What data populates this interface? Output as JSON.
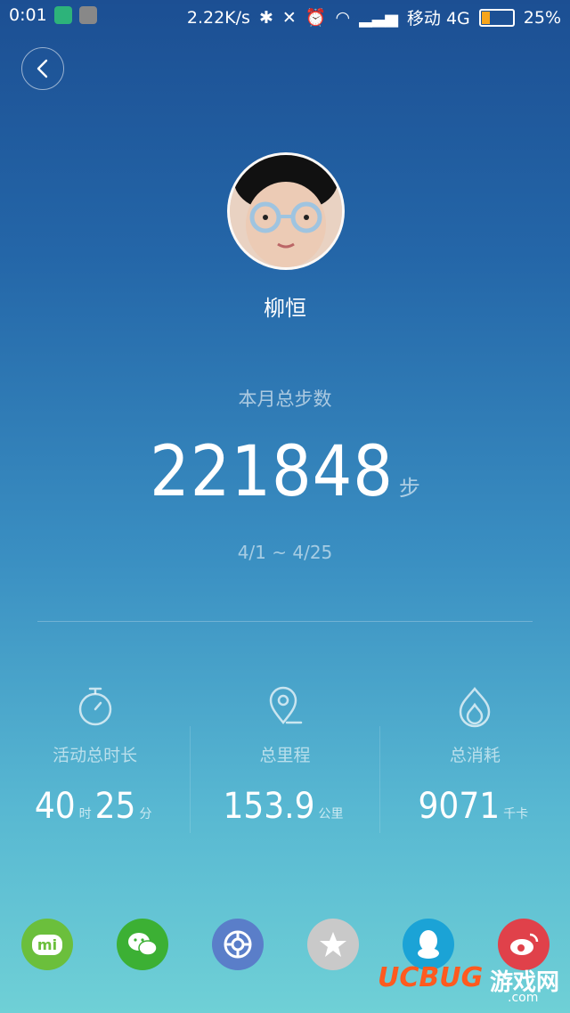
{
  "status_bar": {
    "time": "0:01",
    "network_speed": "2.22K/s",
    "carrier": "移动 4G",
    "battery": "25%",
    "battery_level": 0.25
  },
  "profile": {
    "name": "柳恒"
  },
  "summary": {
    "label": "本月总步数",
    "steps": "221848",
    "unit": "步",
    "date_range": "4/1 ~ 4/25"
  },
  "stats": {
    "duration": {
      "label": "活动总时长",
      "hours": "40",
      "hours_unit": "时",
      "minutes": "25",
      "minutes_unit": "分",
      "icon": "stopwatch-icon"
    },
    "distance": {
      "label": "总里程",
      "value": "153.9",
      "unit": "公里",
      "icon": "location-pin-icon"
    },
    "calories": {
      "label": "总消耗",
      "value": "9071",
      "unit": "千卡",
      "icon": "flame-icon"
    }
  },
  "share": [
    {
      "name": "mi",
      "label": "mi",
      "color": "#6bbf3c"
    },
    {
      "name": "wechat",
      "color": "#3cb034"
    },
    {
      "name": "moments",
      "color": "#5a7ec9"
    },
    {
      "name": "qzone",
      "color": "#c9c9c9"
    },
    {
      "name": "qq",
      "color": "#1ba3d6"
    },
    {
      "name": "weibo",
      "color": "#e0414a"
    }
  ],
  "watermark": {
    "brand": "UCBUG",
    "text": "游戏网",
    "domain": ".com"
  }
}
